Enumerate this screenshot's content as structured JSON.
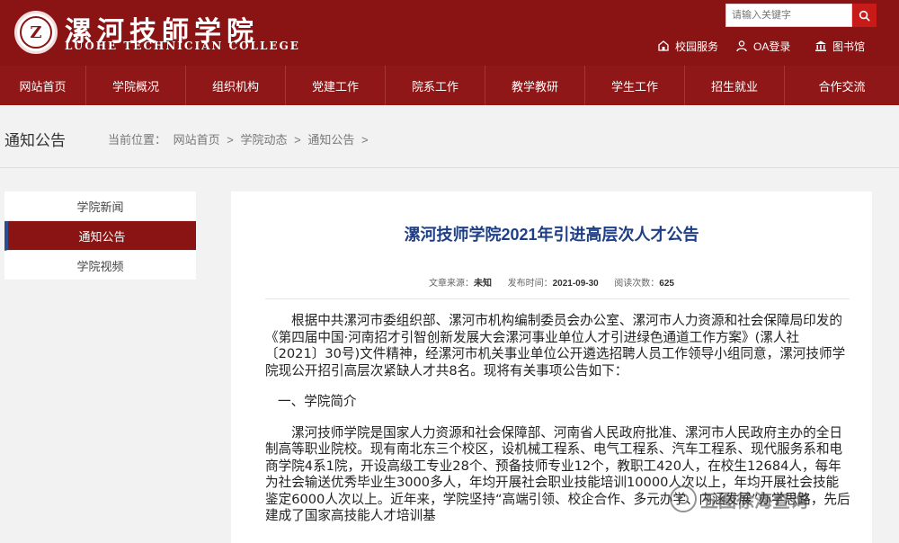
{
  "header": {
    "logo_cn": "漯河技師学院",
    "logo_en": "LUOHE TECHNICIAN COLLEGE",
    "emblem_char": "Z",
    "search_placeholder": "请输入关键字",
    "links": [
      {
        "label": "校园服务",
        "icon": "campus-service-icon"
      },
      {
        "label": "OA登录",
        "icon": "user-login-icon"
      },
      {
        "label": "图书馆",
        "icon": "library-icon"
      }
    ],
    "colors": {
      "brand": "#8a1414",
      "search_button": "#c91a1a",
      "title_blue": "#1e3f86"
    }
  },
  "nav": {
    "items": [
      "网站首页",
      "学院概况",
      "组织机构",
      "党建工作",
      "院系工作",
      "教学教研",
      "学生工作",
      "招生就业",
      "合作交流"
    ]
  },
  "breadcrumb": {
    "section_title": "通知公告",
    "prefix": "当前位置：",
    "items": [
      "网站首页",
      "学院动态",
      "通知公告"
    ],
    "separator": ">"
  },
  "sidebar": {
    "items": [
      {
        "label": "学院新闻",
        "active": false
      },
      {
        "label": "通知公告",
        "active": true
      },
      {
        "label": "学院视频",
        "active": false
      }
    ]
  },
  "article": {
    "title": "漯河技师学院2021年引进高层次人才公告",
    "meta": {
      "source_label": "文章来源：",
      "source_value": "未知",
      "date_label": "发布时间：",
      "date_value": "2021-09-30",
      "views_label": "阅读次数：",
      "views_value": "625"
    },
    "paragraphs": [
      "根据中共漯河市委组织部、漯河市机构编制委员会办公室、漯河市人力资源和社会保障局印发的《第四届中国·河南招才引智创新发展大会漯河事业单位人才引进绿色通道工作方案》(漯人社〔2021〕30号)文件精神，经漯河市机关事业单位公开遴选招聘人员工作领导小组同意，漯河技师学院现公开招引高层次紧缺人才共8名。现将有关事项公告如下：",
      "一、学院简介",
      "漯河技师学院是国家人力资源和社会保障部、河南省人民政府批准、漯河市人民政府主办的全日制高等职业院校。现有南北东三个校区，设机械工程系、电气工程系、汽车工程系、现代服务系和电商学院4系1院，开设高级工专业28个、预备技师专业12个，教职工420人，在校生12684人，每年为社会输送优秀毕业生3000多人，年均开展社会职业技能培训10000人次以上，年均开展社会技能鉴定6000人次以上。近年来，学院坚持“高端引领、校企合作、多元办学、内涵发展”办学思路，先后建成了国家高技能人才培训基"
    ]
  },
  "watermark": {
    "text": "五图徐海查询"
  }
}
